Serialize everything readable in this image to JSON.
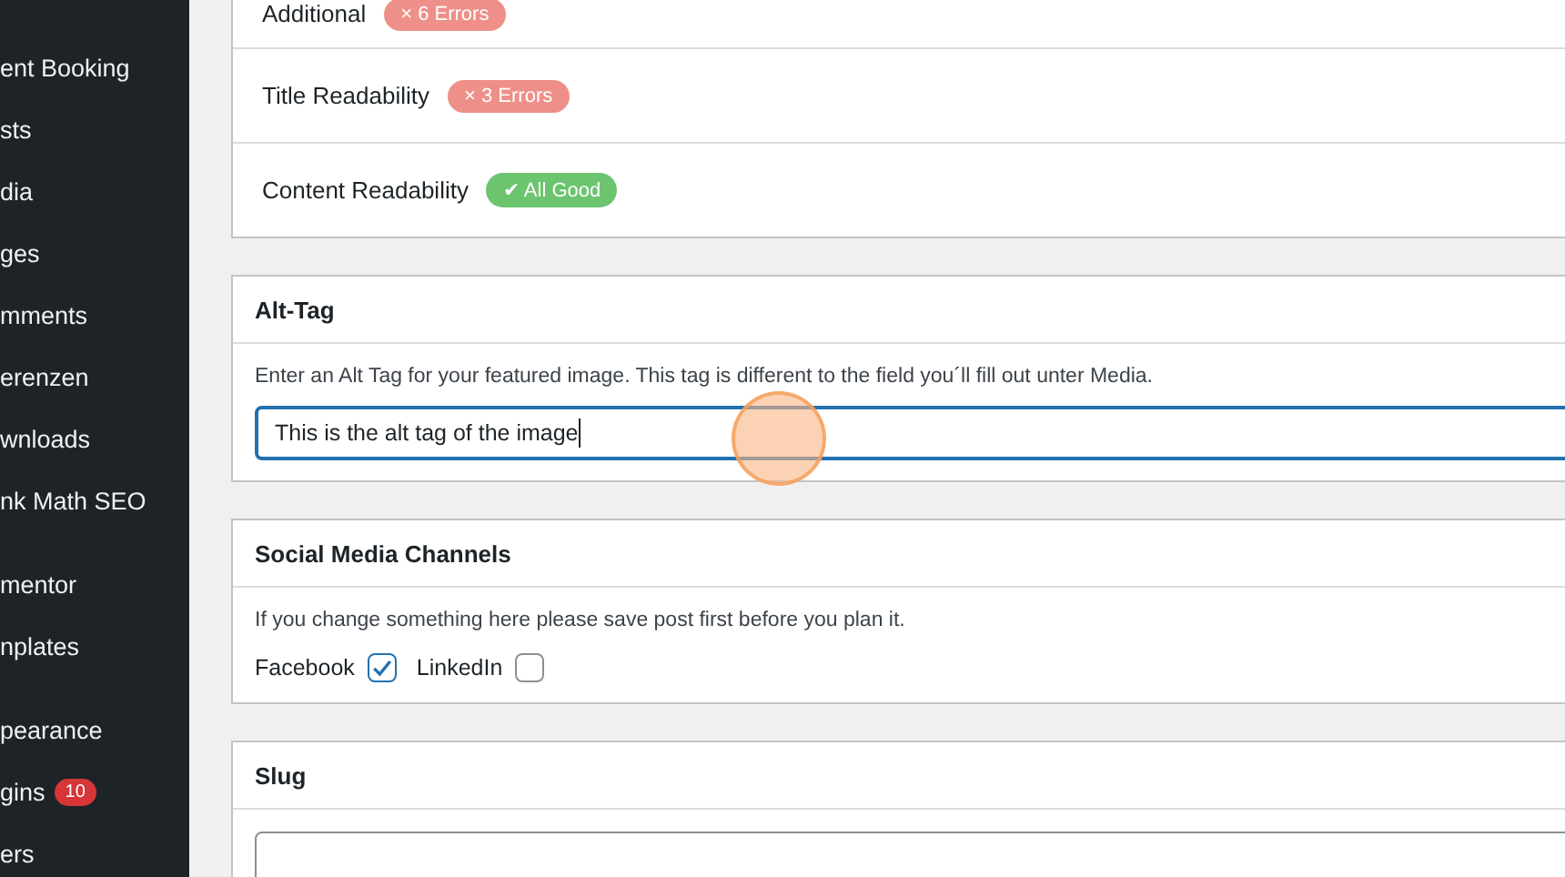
{
  "sidebar": {
    "groups": [
      {
        "items": [
          {
            "label": "ent Booking"
          },
          {
            "label": "sts"
          },
          {
            "label": "dia"
          },
          {
            "label": "ges"
          },
          {
            "label": "mments"
          },
          {
            "label": "erenzen"
          },
          {
            "label": "wnloads"
          },
          {
            "label": "nk Math SEO"
          }
        ]
      },
      {
        "items": [
          {
            "label": "mentor"
          },
          {
            "label": "nplates"
          }
        ]
      },
      {
        "items": [
          {
            "label": "pearance"
          },
          {
            "label": "gins",
            "badge": "10"
          },
          {
            "label": "ers"
          }
        ]
      }
    ]
  },
  "readability": {
    "rows": [
      {
        "label": "Additional",
        "status": {
          "kind": "error",
          "text": "× 6 Errors"
        }
      },
      {
        "label": "Title Readability",
        "status": {
          "kind": "error",
          "text": "× 3 Errors"
        }
      },
      {
        "label": "Content Readability",
        "status": {
          "kind": "good",
          "text": "✔ All Good"
        }
      }
    ]
  },
  "alt_tag": {
    "title": "Alt-Tag",
    "description": "Enter an Alt Tag for your featured image. This tag is different to the field you´ll fill out unter Media.",
    "value": "This is the alt tag of the image",
    "focused": true
  },
  "social": {
    "title": "Social Media Channels",
    "description": "If you change something here please save post first before you plan it.",
    "channels": [
      {
        "label": "Facebook",
        "checked": true
      },
      {
        "label": "LinkedIn",
        "checked": false
      }
    ]
  },
  "slug": {
    "title": "Slug"
  }
}
